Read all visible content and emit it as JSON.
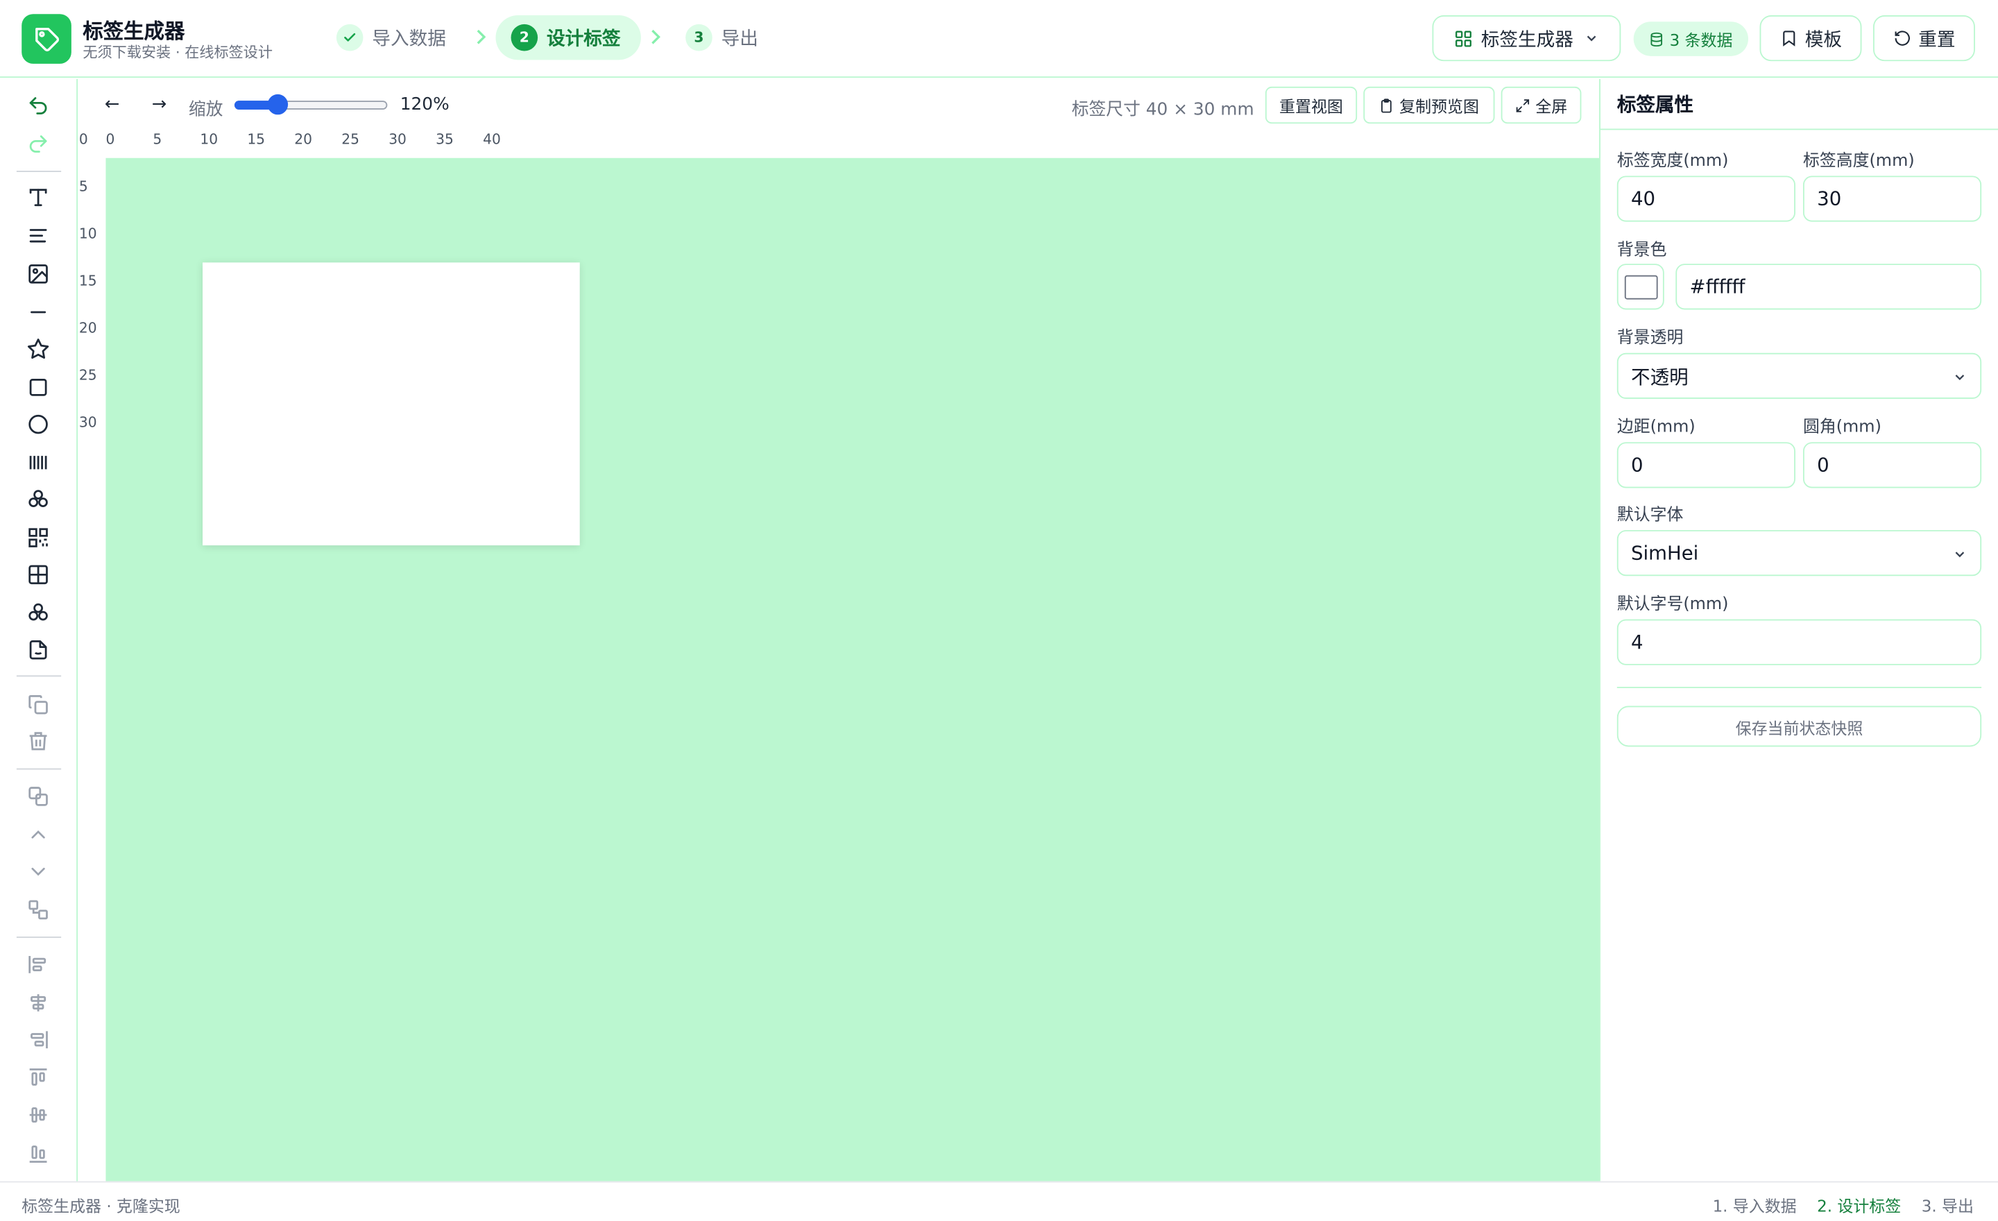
{
  "header": {
    "app_title": "标签生成器",
    "app_subtitle": "无须下载安装 · 在线标签设计",
    "steps": [
      {
        "number": "✓",
        "label": "导入数据",
        "state": "done"
      },
      {
        "number": "2",
        "label": "设计标签",
        "state": "active"
      },
      {
        "number": "3",
        "label": "导出",
        "state": "pending"
      }
    ],
    "app_switch_label": "标签生成器",
    "data_badge": "3 条数据",
    "template_label": "模板",
    "reset_label": "重置"
  },
  "canvas_toolbar": {
    "undo_arrow": "←",
    "redo_arrow": "→",
    "zoom_label": "缩放",
    "zoom_value": "120%",
    "zoom_fraction": 0.28,
    "size_info": "标签尺寸 40 × 30 mm",
    "reset_view_label": "重置视图",
    "copy_preview_label": "复制预览图",
    "fullscreen_label": "全屏"
  },
  "ruler": {
    "corner": "0",
    "horizontal": [
      "0",
      "5",
      "10",
      "15",
      "20",
      "25",
      "30",
      "35",
      "40"
    ],
    "vertical": [
      "5",
      "10",
      "15",
      "20",
      "25",
      "30"
    ]
  },
  "tools": [
    "undo-icon",
    "redo-icon",
    "text-icon",
    "paragraph-icon",
    "image-icon",
    "line-icon",
    "star-icon",
    "rectangle-icon",
    "circle-icon",
    "barcode-icon",
    "shapes-icon",
    "qrcode-icon",
    "table-icon",
    "shapes-icon",
    "sticker-icon",
    "duplicate-icon",
    "delete-icon",
    "group-icon",
    "bring-forward-icon",
    "send-backward-icon",
    "ungroup-icon",
    "align-left-icon",
    "align-center-h-icon",
    "align-right-icon",
    "align-top-icon",
    "align-middle-v-icon",
    "align-bottom-icon"
  ],
  "panel": {
    "title": "标签属性",
    "width_label": "标签宽度(mm)",
    "width_value": "40",
    "height_label": "标签高度(mm)",
    "height_value": "30",
    "bg_color_label": "背景色",
    "bg_color_value": "#ffffff",
    "bg_opacity_label": "背景透明",
    "bg_opacity_value": "不透明",
    "padding_label": "边距(mm)",
    "padding_value": "0",
    "radius_label": "圆角(mm)",
    "radius_value": "0",
    "font_label": "默认字体",
    "font_value": "SimHei",
    "font_size_label": "默认字号(mm)",
    "font_size_value": "4",
    "snapshot_label": "保存当前状态快照"
  },
  "footer": {
    "left": "标签生成器 · 克隆实现",
    "steps": [
      "1. 导入数据",
      "2. 设计标签",
      "3. 导出"
    ]
  },
  "colors": {
    "accent": "#22c55e",
    "accent_dark": "#15803d",
    "stage_bg": "#bbf7d0",
    "slider": "#2563eb"
  }
}
